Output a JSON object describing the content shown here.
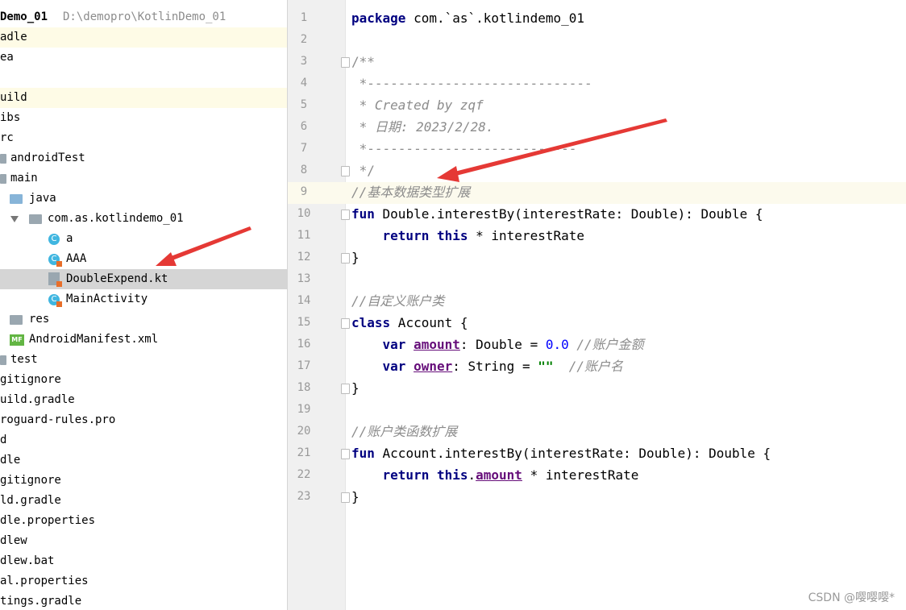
{
  "project": {
    "name": "Demo_01",
    "path": "D:\\demopro\\KotlinDemo_01"
  },
  "tree": [
    {
      "label": "adle",
      "icon": "none",
      "hl": "yellow"
    },
    {
      "label": "ea",
      "icon": "none"
    },
    {
      "label": "",
      "icon": "none"
    },
    {
      "label": "uild",
      "icon": "none",
      "hl": "yellow"
    },
    {
      "label": "ibs",
      "icon": "none"
    },
    {
      "label": "rc",
      "icon": "none"
    },
    {
      "label": "androidTest",
      "icon": "folder-icon"
    },
    {
      "label": "main",
      "icon": "folder-icon"
    },
    {
      "label": "java",
      "icon": "folder-icon"
    },
    {
      "label": "com.as.kotlindemo_01",
      "icon": "package-icon"
    },
    {
      "label": "a",
      "icon": "class-icon"
    },
    {
      "label": "AAA",
      "icon": "kotlin-class-icon"
    },
    {
      "label": "DoubleExpend.kt",
      "icon": "kotlin-file-icon",
      "hl": "selected"
    },
    {
      "label": "MainActivity",
      "icon": "kotlin-class-icon"
    },
    {
      "label": "res",
      "icon": "folder-icon"
    },
    {
      "label": "AndroidManifest.xml",
      "icon": "manifest-icon"
    },
    {
      "label": "test",
      "icon": "folder-icon"
    },
    {
      "label": "gitignore",
      "icon": "none"
    },
    {
      "label": "uild.gradle",
      "icon": "none"
    },
    {
      "label": "roguard-rules.pro",
      "icon": "none"
    },
    {
      "label": "d",
      "icon": "none"
    },
    {
      "label": "dle",
      "icon": "none"
    },
    {
      "label": "gitignore",
      "icon": "none"
    },
    {
      "label": "ld.gradle",
      "icon": "none"
    },
    {
      "label": "dle.properties",
      "icon": "none"
    },
    {
      "label": "dlew",
      "icon": "none"
    },
    {
      "label": "dlew.bat",
      "icon": "none"
    },
    {
      "label": "al.properties",
      "icon": "none"
    },
    {
      "label": "tings.gradle",
      "icon": "none"
    }
  ],
  "editor": {
    "current_line": 9,
    "lines": [
      {
        "n": "1"
      },
      {
        "n": "2"
      },
      {
        "n": "3"
      },
      {
        "n": "4"
      },
      {
        "n": "5"
      },
      {
        "n": "6"
      },
      {
        "n": "7"
      },
      {
        "n": "8"
      },
      {
        "n": "9"
      },
      {
        "n": "10"
      },
      {
        "n": "11"
      },
      {
        "n": "12"
      },
      {
        "n": "13"
      },
      {
        "n": "14"
      },
      {
        "n": "15"
      },
      {
        "n": "16"
      },
      {
        "n": "17"
      },
      {
        "n": "18"
      },
      {
        "n": "19"
      },
      {
        "n": "20"
      },
      {
        "n": "21"
      },
      {
        "n": "22"
      },
      {
        "n": "23"
      }
    ],
    "code": {
      "l1_kw": "package",
      "l1_rest": " com.`as`.kotlindemo_01",
      "l3": "/**",
      "l4": " *-----------------------------",
      "l5": " * Created by zqf",
      "l6": " * 日期: 2023/2/28.",
      "l7": " *---------------------------",
      "l8": " */",
      "l9": "//基本数据类型扩展",
      "l10_kw": "fun",
      "l10_rest": " Double.interestBy(interestRate: Double): Double {",
      "l11_kw1": "return",
      "l11_kw2": "this",
      "l11_rest": " * interestRate",
      "l12": "}",
      "l14": "//自定义账户类",
      "l15_kw": "class",
      "l15_rest": " Account {",
      "l16_kw": "var",
      "l16_prop": "amount",
      "l16_mid": ": Double = ",
      "l16_num": "0.0",
      "l16_cm": " //账户金额",
      "l17_kw": "var",
      "l17_prop": "owner",
      "l17_mid": ": String = ",
      "l17_str": "\"\"",
      "l17_cm": "  //账户名",
      "l18": "}",
      "l20": "//账户类函数扩展",
      "l21_kw": "fun",
      "l21_rest": " Account.interestBy(interestRate: Double): Double {",
      "l22_kw1": "return",
      "l22_kw2": "this",
      "l22_dot": ".",
      "l22_prop": "amount",
      "l22_rest": " * interestRate",
      "l23": "}"
    }
  },
  "watermark": "CSDN @嘤嘤嘤*",
  "colors": {
    "keyword": "#000080",
    "comment": "#8c8c8c",
    "selection": "#d5d5d5",
    "arrow": "#e53935"
  }
}
